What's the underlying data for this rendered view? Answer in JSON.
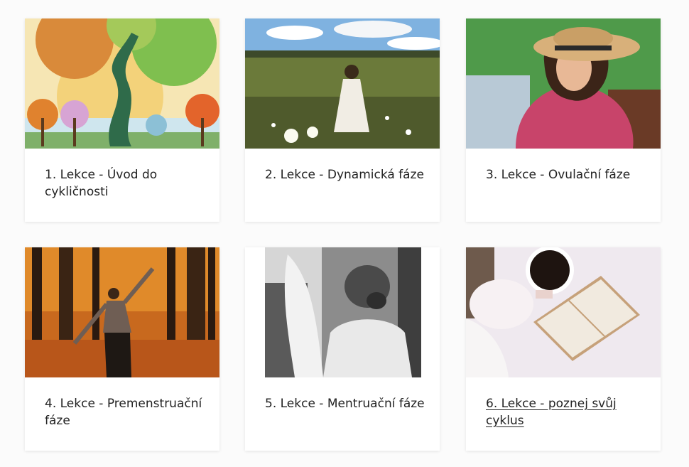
{
  "lessons": [
    {
      "title": "1. Lekce - Úvod do cykličnosti",
      "image": "seasonal-tree-illustration"
    },
    {
      "title": "2. Lekce - Dynamická fáze",
      "image": "woman-walking-in-flower-meadow"
    },
    {
      "title": "3. Lekce - Ovulační fáze",
      "image": "woman-in-straw-hat-lying-on-picnic-blanket"
    },
    {
      "title": "4. Lekce - Premenstruační fáze",
      "image": "woman-dancing-in-autumn-forest"
    },
    {
      "title": "5. Lekce - Mentruační fáze",
      "image": "woman-resting-black-and-white"
    },
    {
      "title": "6. Lekce - poznej svůj cyklus",
      "image": "coffee-cup-and-open-book"
    }
  ],
  "colors": {
    "background": "#fbfbfb",
    "card": "#ffffff",
    "text": "#222222"
  }
}
